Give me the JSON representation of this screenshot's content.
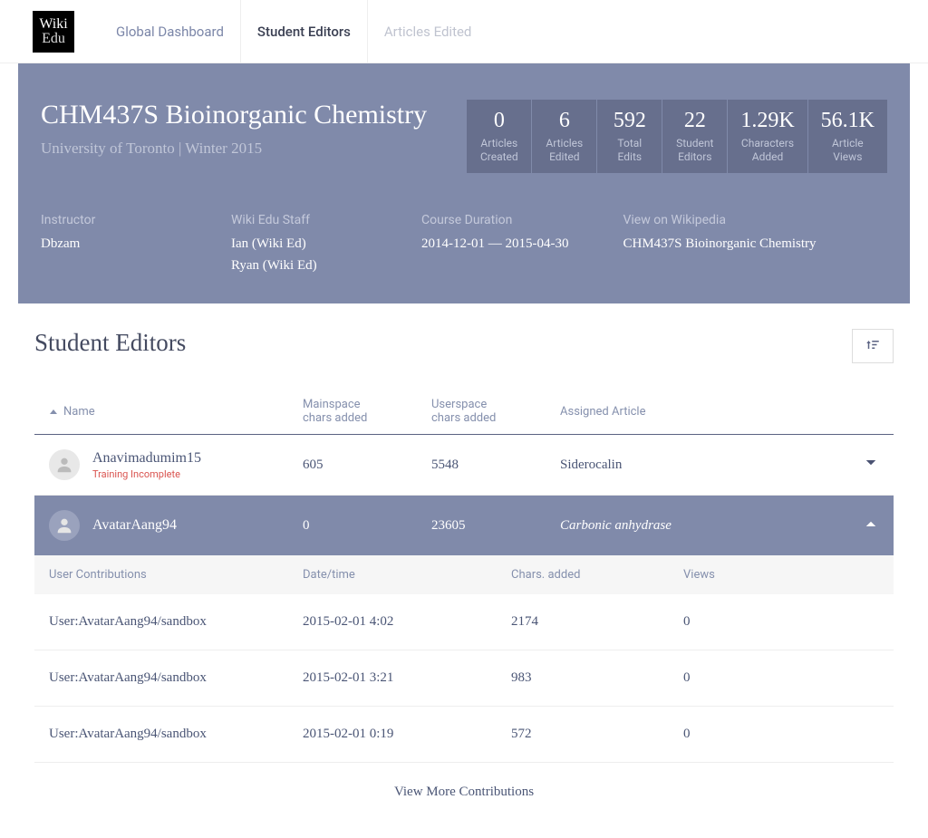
{
  "logo": {
    "line1": "Wiki",
    "line2": "Edu"
  },
  "nav": {
    "global": "Global Dashboard",
    "student_editors": "Student Editors",
    "articles_edited": "Articles Edited"
  },
  "course": {
    "title": "CHM437S Bioinorganic Chemistry",
    "subtitle": "University of Toronto | Winter 2015"
  },
  "stats": [
    {
      "value": "0",
      "label1": "Articles",
      "label2": "Created"
    },
    {
      "value": "6",
      "label1": "Articles",
      "label2": "Edited"
    },
    {
      "value": "592",
      "label1": "Total",
      "label2": "Edits"
    },
    {
      "value": "22",
      "label1": "Student",
      "label2": "Editors"
    },
    {
      "value": "1.29K",
      "label1": "Characters",
      "label2": "Added"
    },
    {
      "value": "56.1K",
      "label1": "Article",
      "label2": "Views"
    }
  ],
  "meta": {
    "instructor_label": "Instructor",
    "instructor_value": "Dbzam",
    "staff_label": "Wiki Edu Staff",
    "staff_value1": "Ian (Wiki Ed)",
    "staff_value2": "Ryan (Wiki Ed)",
    "duration_label": "Course Duration",
    "duration_value": "2014-12-01 — 2015-04-30",
    "wikipedia_label": "View on Wikipedia",
    "wikipedia_value": "CHM437S Bioinorganic Chemistry"
  },
  "section": {
    "title": "Student Editors"
  },
  "headers": {
    "name": "Name",
    "mainspace1": "Mainspace",
    "mainspace2": "chars added",
    "userspace1": "Userspace",
    "userspace2": "chars added",
    "assigned": "Assigned Article"
  },
  "students": [
    {
      "name": "Anavimadumim15",
      "note": "Training Incomplete",
      "mainspace": "605",
      "userspace": "5548",
      "assigned": "Siderocalin"
    },
    {
      "name": "AvatarAang94",
      "note": "",
      "mainspace": "0",
      "userspace": "23605",
      "assigned": "Carbonic anhydrase"
    }
  ],
  "contrib": {
    "h_user": "User Contributions",
    "h_date": "Date/time",
    "h_chars": "Chars. added",
    "h_views": "Views",
    "rows": [
      {
        "page": "User:AvatarAang94/sandbox",
        "datetime": "2015-02-01 4:02",
        "chars": "2174",
        "views": "0"
      },
      {
        "page": "User:AvatarAang94/sandbox",
        "datetime": "2015-02-01 3:21",
        "chars": "983",
        "views": "0"
      },
      {
        "page": "User:AvatarAang94/sandbox",
        "datetime": "2015-02-01 0:19",
        "chars": "572",
        "views": "0"
      }
    ],
    "view_more": "View More Contributions"
  }
}
